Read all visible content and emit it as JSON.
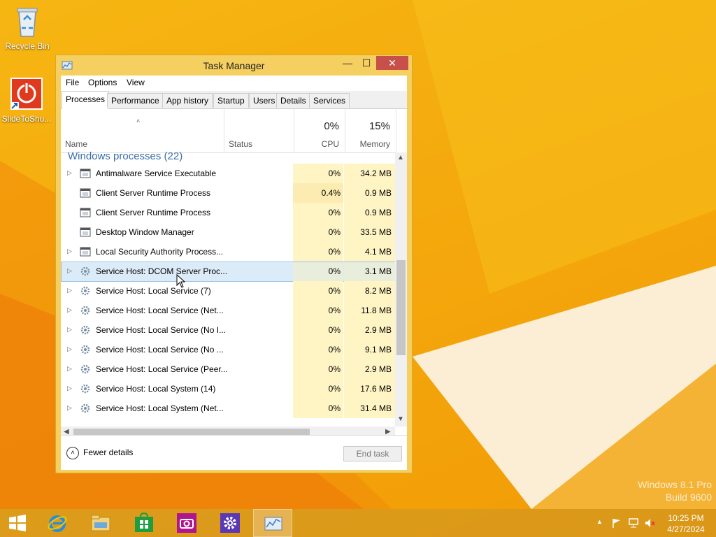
{
  "desktop": {
    "icons": [
      {
        "label": "Recycle Bin"
      },
      {
        "label": "SlideToShu..."
      }
    ],
    "watermark": {
      "line1": "Windows 8.1 Pro",
      "line2": "Build 9600"
    }
  },
  "window": {
    "title": "Task Manager",
    "controls": {
      "minimize": "—",
      "maximize": "☐",
      "close": "✕"
    },
    "menu": [
      "File",
      "Options",
      "View"
    ],
    "tabs": [
      "Processes",
      "Performance",
      "App history",
      "Startup",
      "Users",
      "Details",
      "Services"
    ],
    "active_tab": "Processes",
    "columns": {
      "name": "Name",
      "status": "Status",
      "cpu": {
        "percent": "0%",
        "label": "CPU"
      },
      "memory": {
        "percent": "15%",
        "label": "Memory"
      }
    },
    "group_label": "Windows processes (22)",
    "processes": [
      {
        "name": "Antimalware Service Executable",
        "cpu": "0%",
        "memory": "34.2 MB",
        "expandable": true,
        "icon": "app-window-icon"
      },
      {
        "name": "Client Server Runtime Process",
        "cpu": "0.4%",
        "memory": "0.9 MB",
        "expandable": false,
        "icon": "app-window-icon"
      },
      {
        "name": "Client Server Runtime Process",
        "cpu": "0%",
        "memory": "0.9 MB",
        "expandable": false,
        "icon": "app-window-icon"
      },
      {
        "name": "Desktop Window Manager",
        "cpu": "0%",
        "memory": "33.5 MB",
        "expandable": false,
        "icon": "app-window-icon"
      },
      {
        "name": "Local Security Authority Process...",
        "cpu": "0%",
        "memory": "4.1 MB",
        "expandable": true,
        "icon": "app-window-icon"
      },
      {
        "name": "Service Host: DCOM Server Proc...",
        "cpu": "0%",
        "memory": "3.1 MB",
        "expandable": true,
        "icon": "gear-icon",
        "selected": true
      },
      {
        "name": "Service Host: Local Service (7)",
        "cpu": "0%",
        "memory": "8.2 MB",
        "expandable": true,
        "icon": "gear-icon"
      },
      {
        "name": "Service Host: Local Service (Net...",
        "cpu": "0%",
        "memory": "11.8 MB",
        "expandable": true,
        "icon": "gear-icon"
      },
      {
        "name": "Service Host: Local Service (No I...",
        "cpu": "0%",
        "memory": "2.9 MB",
        "expandable": true,
        "icon": "gear-icon"
      },
      {
        "name": "Service Host: Local Service (No ...",
        "cpu": "0%",
        "memory": "9.1 MB",
        "expandable": true,
        "icon": "gear-icon"
      },
      {
        "name": "Service Host: Local Service (Peer...",
        "cpu": "0%",
        "memory": "2.9 MB",
        "expandable": true,
        "icon": "gear-icon"
      },
      {
        "name": "Service Host: Local System (14)",
        "cpu": "0%",
        "memory": "17.6 MB",
        "expandable": true,
        "icon": "gear-icon"
      },
      {
        "name": "Service Host: Local System (Net...",
        "cpu": "0%",
        "memory": "31.4 MB",
        "expandable": true,
        "icon": "gear-icon"
      }
    ],
    "footer": {
      "fewer_details": "Fewer details",
      "end_task": "End task"
    }
  },
  "taskbar": {
    "apps": [
      "start-icon",
      "internet-explorer-icon",
      "file-explorer-icon",
      "store-icon",
      "camera-icon",
      "settings-icon",
      "task-manager-icon"
    ],
    "active_app": "task-manager-icon",
    "clock": {
      "time": "10:25 PM",
      "date": "4/27/2024"
    }
  },
  "colors": {
    "accent": "#3a6ea5",
    "wallpaper": "#f4a90d",
    "close_button": "#c7504a",
    "selection": "#dcebf8"
  }
}
